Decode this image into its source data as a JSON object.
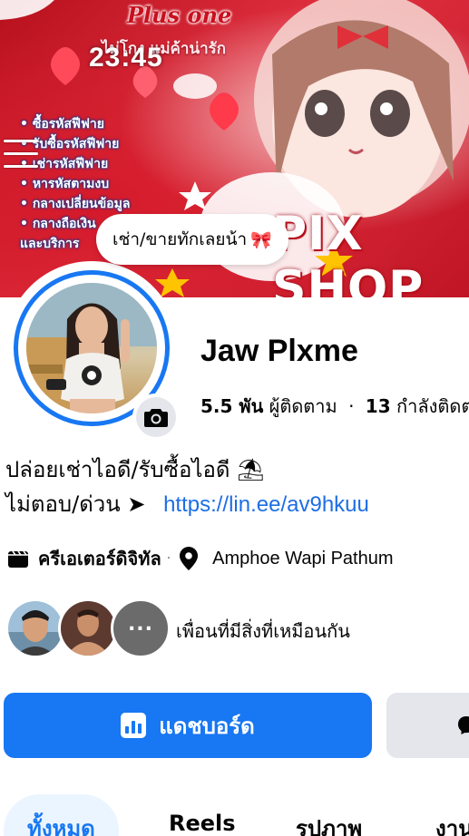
{
  "status_bar": {
    "time": "23:45"
  },
  "cover": {
    "heading": "Plus one",
    "subheading": "ไม่โกง แม่ค้าน่ารัก",
    "services": [
      "ซื้อรหัสฟีฟาย",
      "รับซื้อรหัสฟีฟาย",
      "เช่ารหัสฟีฟาย",
      "หารหัสตามงบ",
      "กลางเปลี่ยนข้อมูล",
      "กลางถือเงิน"
    ],
    "services_cont": "และบริการ",
    "shop_text": "PIX SHOP"
  },
  "note": {
    "text": "เช่า/ขายทักเลยน้า",
    "emoji": "🎀"
  },
  "profile": {
    "name": "Jaw Plxme",
    "followers_count": "5.5 พัน",
    "followers_label": "ผู้ติดตาม",
    "following_count": "13",
    "following_label": "กำลังติดตาม",
    "separator": "·"
  },
  "bio": {
    "line1": "ปล่อยเช่าไอดี/รับซื้อไอดี",
    "line1_emoji": "⛱",
    "line2_prefix": "ไม่ตอบ/ด่วน ➤",
    "link": "https://lin.ee/av9hkuu"
  },
  "info": {
    "category_icon": "clapperboard-icon",
    "category": "ครีเอเตอร์ดิจิทัล",
    "location_icon": "location-pin-icon",
    "location": "Amphoe Wapi Pathum"
  },
  "mutual": {
    "label": "เพื่อนที่มีสิ่งที่เหมือนกัน",
    "more_label": "..."
  },
  "actions": {
    "dashboard_label": "แดชบอร์ด",
    "dashboard_icon": "bar-chart-icon",
    "second_icon": "messenger-icon"
  },
  "tabs": [
    {
      "label": "ทั้งหมด",
      "active": true
    },
    {
      "label": "Reels",
      "active": false
    },
    {
      "label": "รูปภาพ",
      "active": false
    },
    {
      "label": "งาน",
      "active": false
    }
  ],
  "colors": {
    "accent": "#1877f2",
    "link": "#1d6ee6",
    "tab_active_bg": "#ebf5ff",
    "secondary_button_bg": "#e4e6eb"
  }
}
